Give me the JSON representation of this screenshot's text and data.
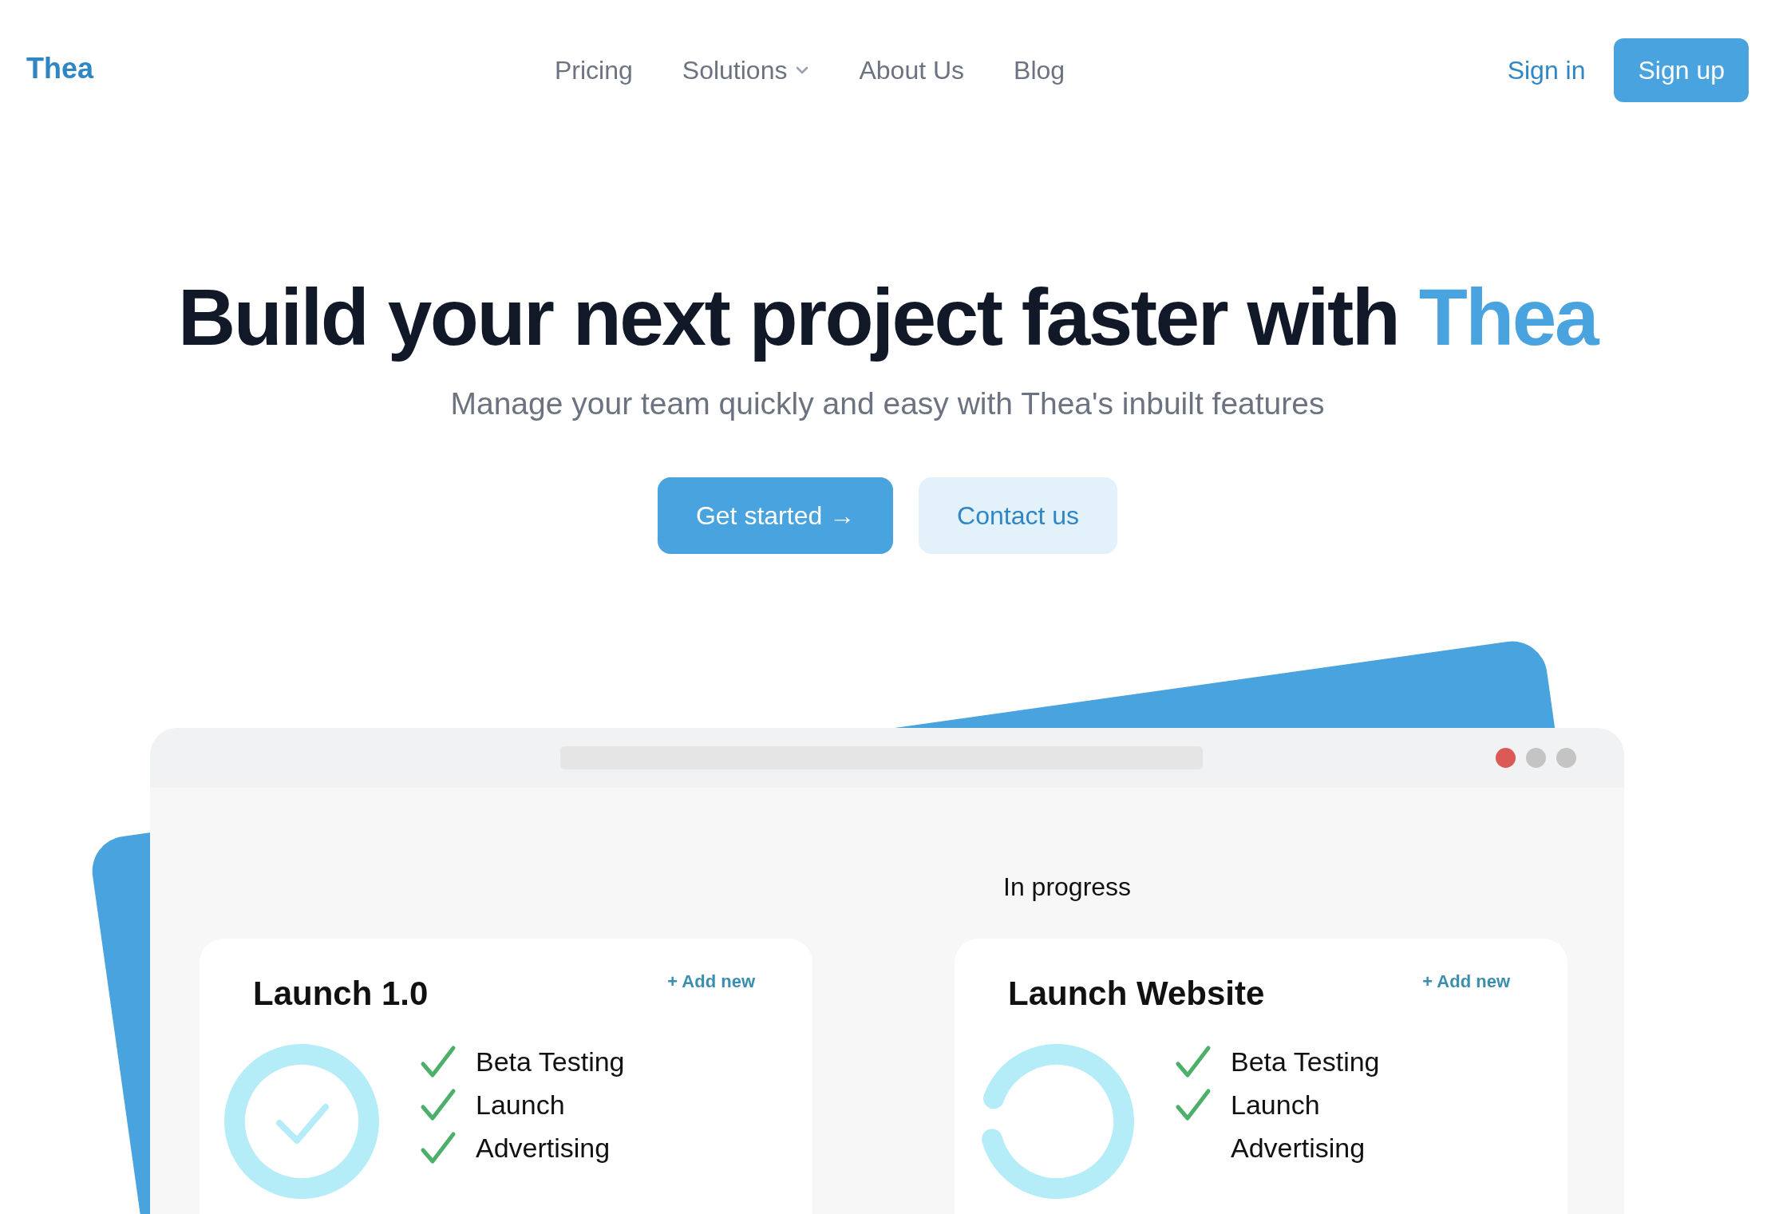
{
  "brand": "Thea",
  "nav": [
    {
      "label": "Pricing",
      "dropdown": false
    },
    {
      "label": "Solutions",
      "dropdown": true
    },
    {
      "label": "About Us",
      "dropdown": false
    },
    {
      "label": "Blog",
      "dropdown": false
    }
  ],
  "auth": {
    "sign_in": "Sign in",
    "sign_up": "Sign up"
  },
  "hero": {
    "title": "Build your next project faster with",
    "title_accent": "Thea",
    "subtitle": "Manage your team quickly and easy with Thea's inbuilt features",
    "primary_button": "Get started →",
    "secondary_button": "Contact us"
  },
  "mockup": {
    "column_title": "In progress",
    "cards": [
      {
        "title": "Launch 1.0",
        "add_link": "+ Add new",
        "level": 1,
        "tasks": [
          {
            "label": "Beta Testing",
            "done": true
          },
          {
            "label": "Launch",
            "done": true
          },
          {
            "label": "Advertising",
            "done": true
          }
        ]
      },
      {
        "title": "Launch Website",
        "add_link": "+ Add new",
        "level": 0.9,
        "tasks": [
          {
            "label": "Beta Testing",
            "done": true
          },
          {
            "label": "Launch",
            "done": true
          },
          {
            "label": "Advertising",
            "done": false
          }
        ]
      }
    ]
  }
}
